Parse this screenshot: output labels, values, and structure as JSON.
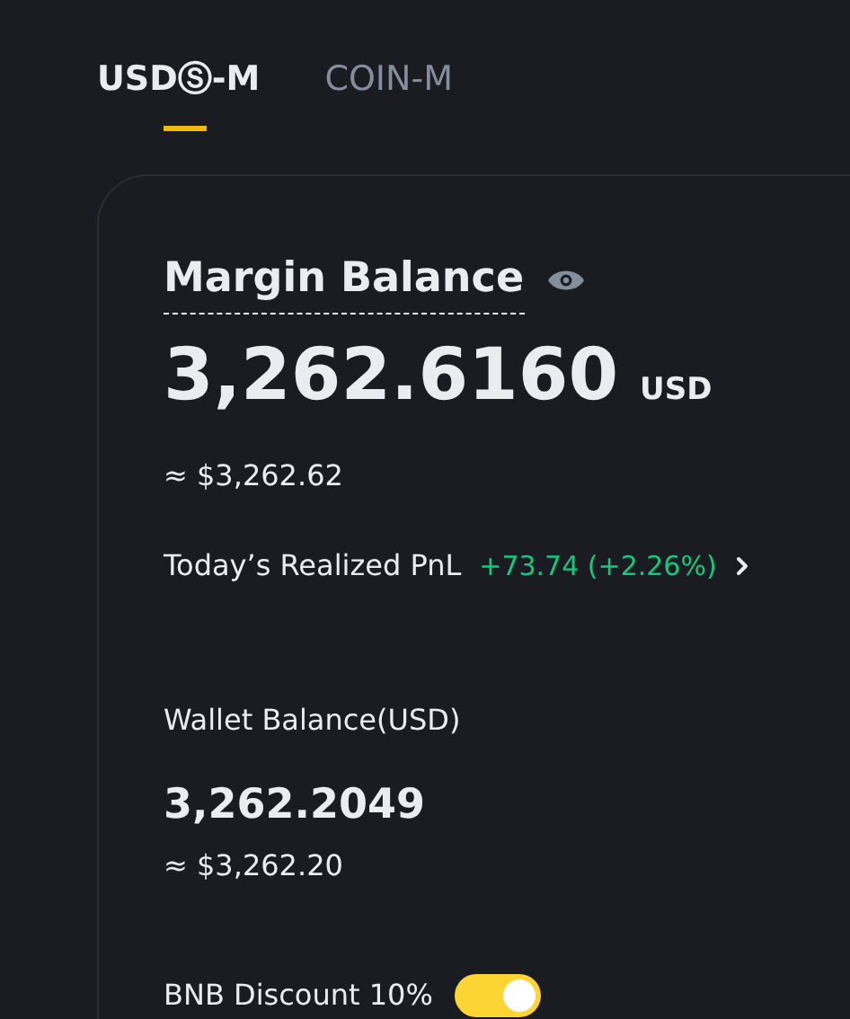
{
  "tabs": [
    {
      "label": "USDⓈ-M",
      "selected": true
    },
    {
      "label": "COIN-M",
      "selected": false
    }
  ],
  "margin_balance": {
    "title": "Margin Balance",
    "value": "3,262.6160",
    "unit": "USD",
    "approx": "≈ $3,262.62"
  },
  "realized_pnl": {
    "label": "Today’s Realized PnL",
    "value": "+73.74 (+2.26%)",
    "positive": true
  },
  "wallet_balance": {
    "label": "Wallet Balance(USD)",
    "value": "3,262.2049",
    "approx": "≈ $3,262.20"
  },
  "bnb_discount": {
    "label": "BNB Discount 10%",
    "on": true
  }
}
